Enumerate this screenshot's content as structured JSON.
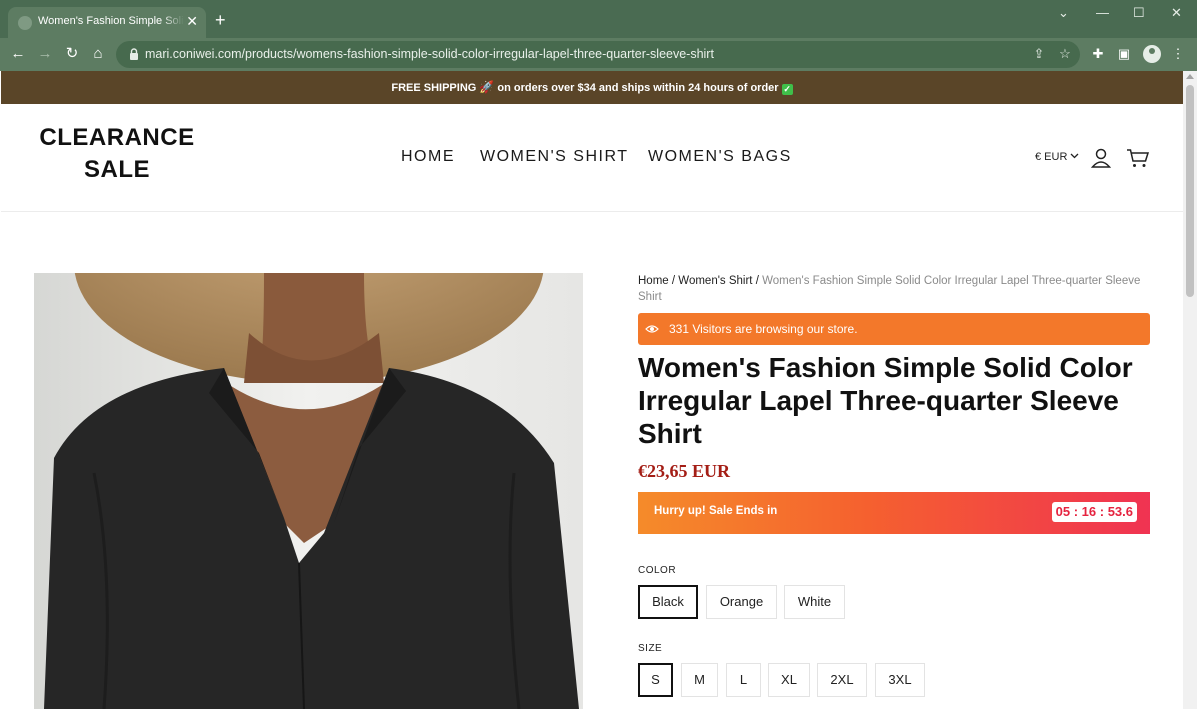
{
  "browser": {
    "tab_title": "Women's Fashion Simple Solid Color Irregular Lapel Three-quarter Sleeve Shirt",
    "url": "mari.coniwei.com/products/womens-fashion-simple-solid-color-irregular-lapel-three-quarter-sleeve-shirt"
  },
  "announcement": {
    "text_before": "FREE SHIPPING",
    "text_after": "on orders over $34 and ships within 24 hours of order"
  },
  "header": {
    "logo_line1": "CLEARANCE",
    "logo_line2": "SALE",
    "nav": [
      {
        "label": "HOME"
      },
      {
        "label": "WOMEN'S SHIRT"
      },
      {
        "label": "WOMEN'S BAGS"
      }
    ],
    "currency": "€ EUR"
  },
  "product": {
    "breadcrumb": {
      "home": "Home",
      "sep": "/",
      "category": "Women's Shirt",
      "current": "Women's Fashion Simple Solid Color Irregular Lapel Three-quarter Sleeve Shirt"
    },
    "visitors": "331 Visitors are browsing our store.",
    "title": "Women's Fashion Simple Solid Color Irregular Lapel Three-quarter Sleeve Shirt",
    "price": "€23,65 EUR",
    "sale_text": "Hurry up! Sale Ends in",
    "timer": "05 : 16 : 53.6",
    "color_label": "COLOR",
    "colors": [
      "Black",
      "Orange",
      "White"
    ],
    "selected_color": "Black",
    "size_label": "SIZE",
    "sizes": [
      "S",
      "M",
      "L",
      "XL",
      "2XL",
      "3XL"
    ],
    "selected_size": "S"
  },
  "colors": {
    "chrome_title": "#4a6b52",
    "chrome_toolbar": "#5d7c62",
    "announcement_bg": "#5a4528",
    "visitors_bg": "#f3782a",
    "price": "#a41e16",
    "timer_text": "#e5233f"
  }
}
